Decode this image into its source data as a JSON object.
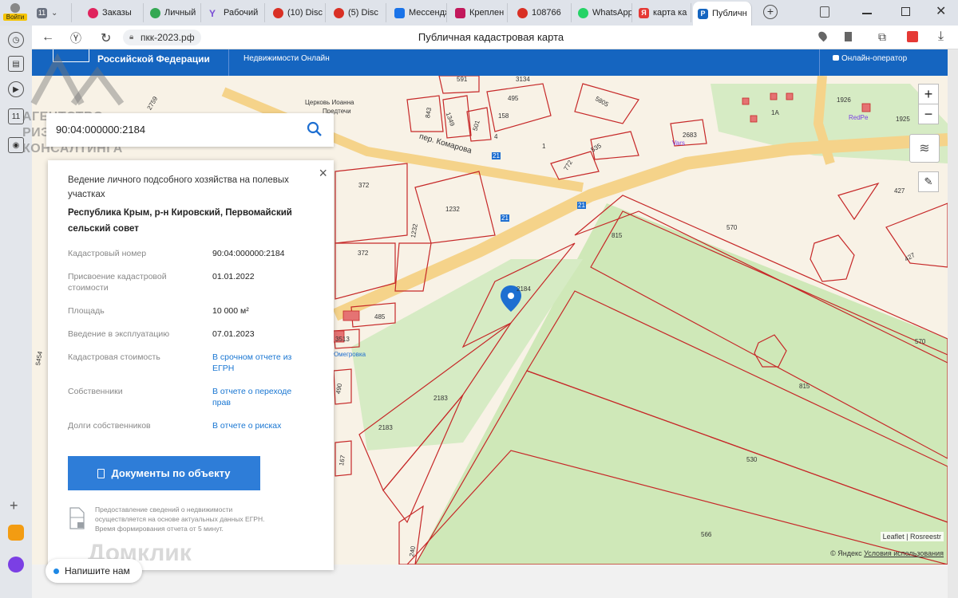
{
  "browser": {
    "tabs": [
      {
        "label": "11",
        "color": "#6b7280"
      },
      {
        "label": "Заказы",
        "color": "#e0245e"
      },
      {
        "label": "Личный",
        "color": "#34a853"
      },
      {
        "label": "Рабочий",
        "color": "#7b4fd6"
      },
      {
        "label": "(10) Disc",
        "color": "#d93025"
      },
      {
        "label": "(5) Disc",
        "color": "#d93025"
      },
      {
        "label": "Мессенджер",
        "color": "#1a73e8"
      },
      {
        "label": "Креплен",
        "color": "#c2185b"
      },
      {
        "label": "108766",
        "color": "#d93025"
      },
      {
        "label": "WhatsApp",
        "color": "#25d366"
      },
      {
        "label": "карта ка",
        "color": "#e53935"
      },
      {
        "label": "Публичн",
        "color": "#1565c0"
      }
    ],
    "login_label": "Войти",
    "site": "пкк-2023.рф",
    "page_title": "Публичная кадастровая карта"
  },
  "header": {
    "org": "Российской Федерации",
    "service": "Недвижимости Онлайн",
    "operator": "Онлайн-оператор"
  },
  "search": {
    "value": "90:04:000000:2184"
  },
  "card": {
    "land_use": "Ведение личного подсобного хозяйства на полевых участках",
    "address": "Республика Крым, р-н Кировский, Первомайский сельский совет",
    "rows": [
      {
        "label": "Кадастровый номер",
        "value": "90:04:000000:2184"
      },
      {
        "label": "Присвоение кадастровой стоимости",
        "value": "01.01.2022"
      },
      {
        "label": "Площадь",
        "value": "10 000 м²"
      },
      {
        "label": "Введение в эксплуатацию",
        "value": "07.01.2023"
      },
      {
        "label": "Кадастровая стоимость",
        "value": "В срочном отчете из ЕГРН"
      },
      {
        "label": "Собственники",
        "value": "В отчете о переходе прав"
      },
      {
        "label": "Долги собственников",
        "value": "В отчете о рисках"
      }
    ],
    "docs_button": "Документы по объекту",
    "note": "Предоставление сведений о недвижимости осуществляется на основе актуальных данных ЕГРН. Время формирования отчета от 5 минут."
  },
  "chat": {
    "label": "Напишите нам"
  },
  "map": {
    "labels": [
      "372",
      "1232",
      "1232",
      "372",
      "591",
      "3134",
      "495",
      "158",
      "843",
      "1349",
      "501",
      "4",
      "1",
      "772",
      "535",
      "5805",
      "Церковь Иоанна",
      "Предтечи",
      "пер. Комарова",
      "2683",
      "Vars",
      "1926",
      "1925",
      "RedPe",
      "1A",
      "427",
      "427",
      "570",
      "570",
      "815",
      "815",
      "2184",
      "2183",
      "2183",
      "530",
      "566",
      "485",
      "3513",
      "Юмегровка",
      "490",
      "167",
      "240",
      "5454",
      "2759",
      "21",
      "21",
      "21"
    ],
    "zoom_in": "+",
    "zoom_out": "−",
    "attribution": "Leaflet | Rosreestr",
    "yandex": "© Яндекс",
    "terms": "Условия использования"
  },
  "watermark": {
    "line1": "АГЕНТСТВО",
    "line2": "РИЭЛТОРСКОГО",
    "line3": "КОНСАЛТИНГА",
    "domclick": "Домклик"
  }
}
